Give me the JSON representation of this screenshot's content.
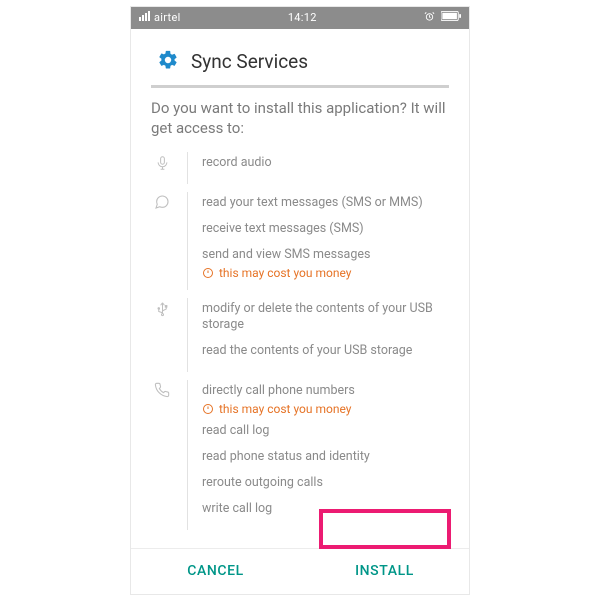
{
  "statusbar": {
    "carrier": "airtel",
    "time": "14:12"
  },
  "header": {
    "app_title": "Sync Services"
  },
  "prompt": "Do you want to install this application? It will get access to:",
  "permissions": {
    "audio": {
      "items": [
        "record audio"
      ]
    },
    "sms": {
      "items": [
        "read your text messages (SMS or MMS)",
        "receive text messages (SMS)",
        "send and view SMS messages"
      ],
      "warning": "this may cost you money"
    },
    "storage": {
      "items": [
        "modify or delete the contents of your USB storage",
        "read the contents of your USB storage"
      ]
    },
    "phone": {
      "items": [
        "directly call phone numbers"
      ],
      "warning": "this may cost you money",
      "more": [
        "read call log",
        "read phone status and identity",
        "reroute outgoing calls",
        "write call log"
      ]
    }
  },
  "buttons": {
    "cancel": "Cancel",
    "install": "Install"
  }
}
